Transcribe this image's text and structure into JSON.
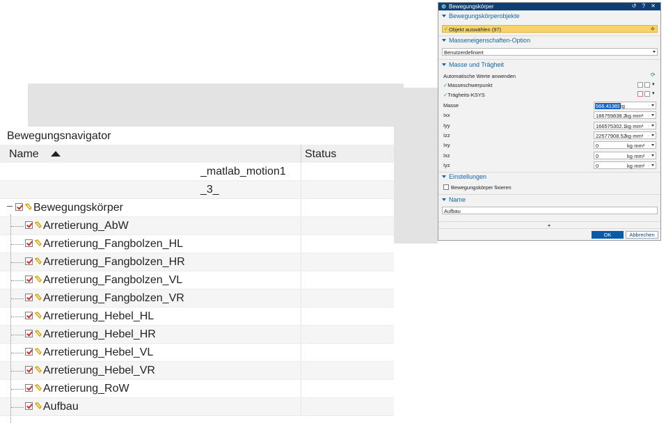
{
  "navigator": {
    "title": "Bewegungsnavigator",
    "columns": {
      "name": "Name",
      "status": "Status"
    },
    "top_items": [
      "_matlab_motion1",
      "_3_"
    ],
    "root": "Bewegungskörper",
    "children": [
      "Arretierung_AbW",
      "Arretierung_Fangbolzen_HL",
      "Arretierung_Fangbolzen_HR",
      "Arretierung_Fangbolzen_VL",
      "Arretierung_Fangbolzen_VR",
      "Arretierung_Hebel_HL",
      "Arretierung_Hebel_HR",
      "Arretierung_Hebel_VL",
      "Arretierung_Hebel_VR",
      "Arretierung_RoW",
      "Aufbau"
    ]
  },
  "dialog": {
    "title": "Bewegungskörper",
    "title_buttons": "↺ ? ✕",
    "sections": {
      "objects": "Bewegungskörperobjekte",
      "mass_option": "Masseneigenschaften-Option",
      "mass_inertia": "Masse und Trägheit",
      "settings": "Einstellungen",
      "name": "Name"
    },
    "select_object": "Objekt auswählen (97)",
    "mass_option_value": "Benutzerdefiniert",
    "auto_values": "Automatische Werte anwenden",
    "center_of_mass": "Masseschwerpunkt",
    "inertia_csys": "Trägheits-KSYS",
    "fields": [
      {
        "label": "Masse",
        "value": "566.41369",
        "unit": "kg"
      },
      {
        "label": "Ixx",
        "value": "186759838.2",
        "unit": "kg·mm²"
      },
      {
        "label": "Iyy",
        "value": "166575302.1",
        "unit": "kg·mm²"
      },
      {
        "label": "Izz",
        "value": "22577908.52",
        "unit": "kg·mm²"
      },
      {
        "label": "Ixy",
        "value": "0",
        "unit": "kg·mm²"
      },
      {
        "label": "Ixz",
        "value": "0",
        "unit": "kg·mm²"
      },
      {
        "label": "Iyz",
        "value": "0",
        "unit": "kg·mm²"
      }
    ],
    "fix_body": "Bewegungskörper fixieren",
    "name_value": "Aufbau",
    "ok": "OK",
    "cancel": "Abbrechen"
  }
}
